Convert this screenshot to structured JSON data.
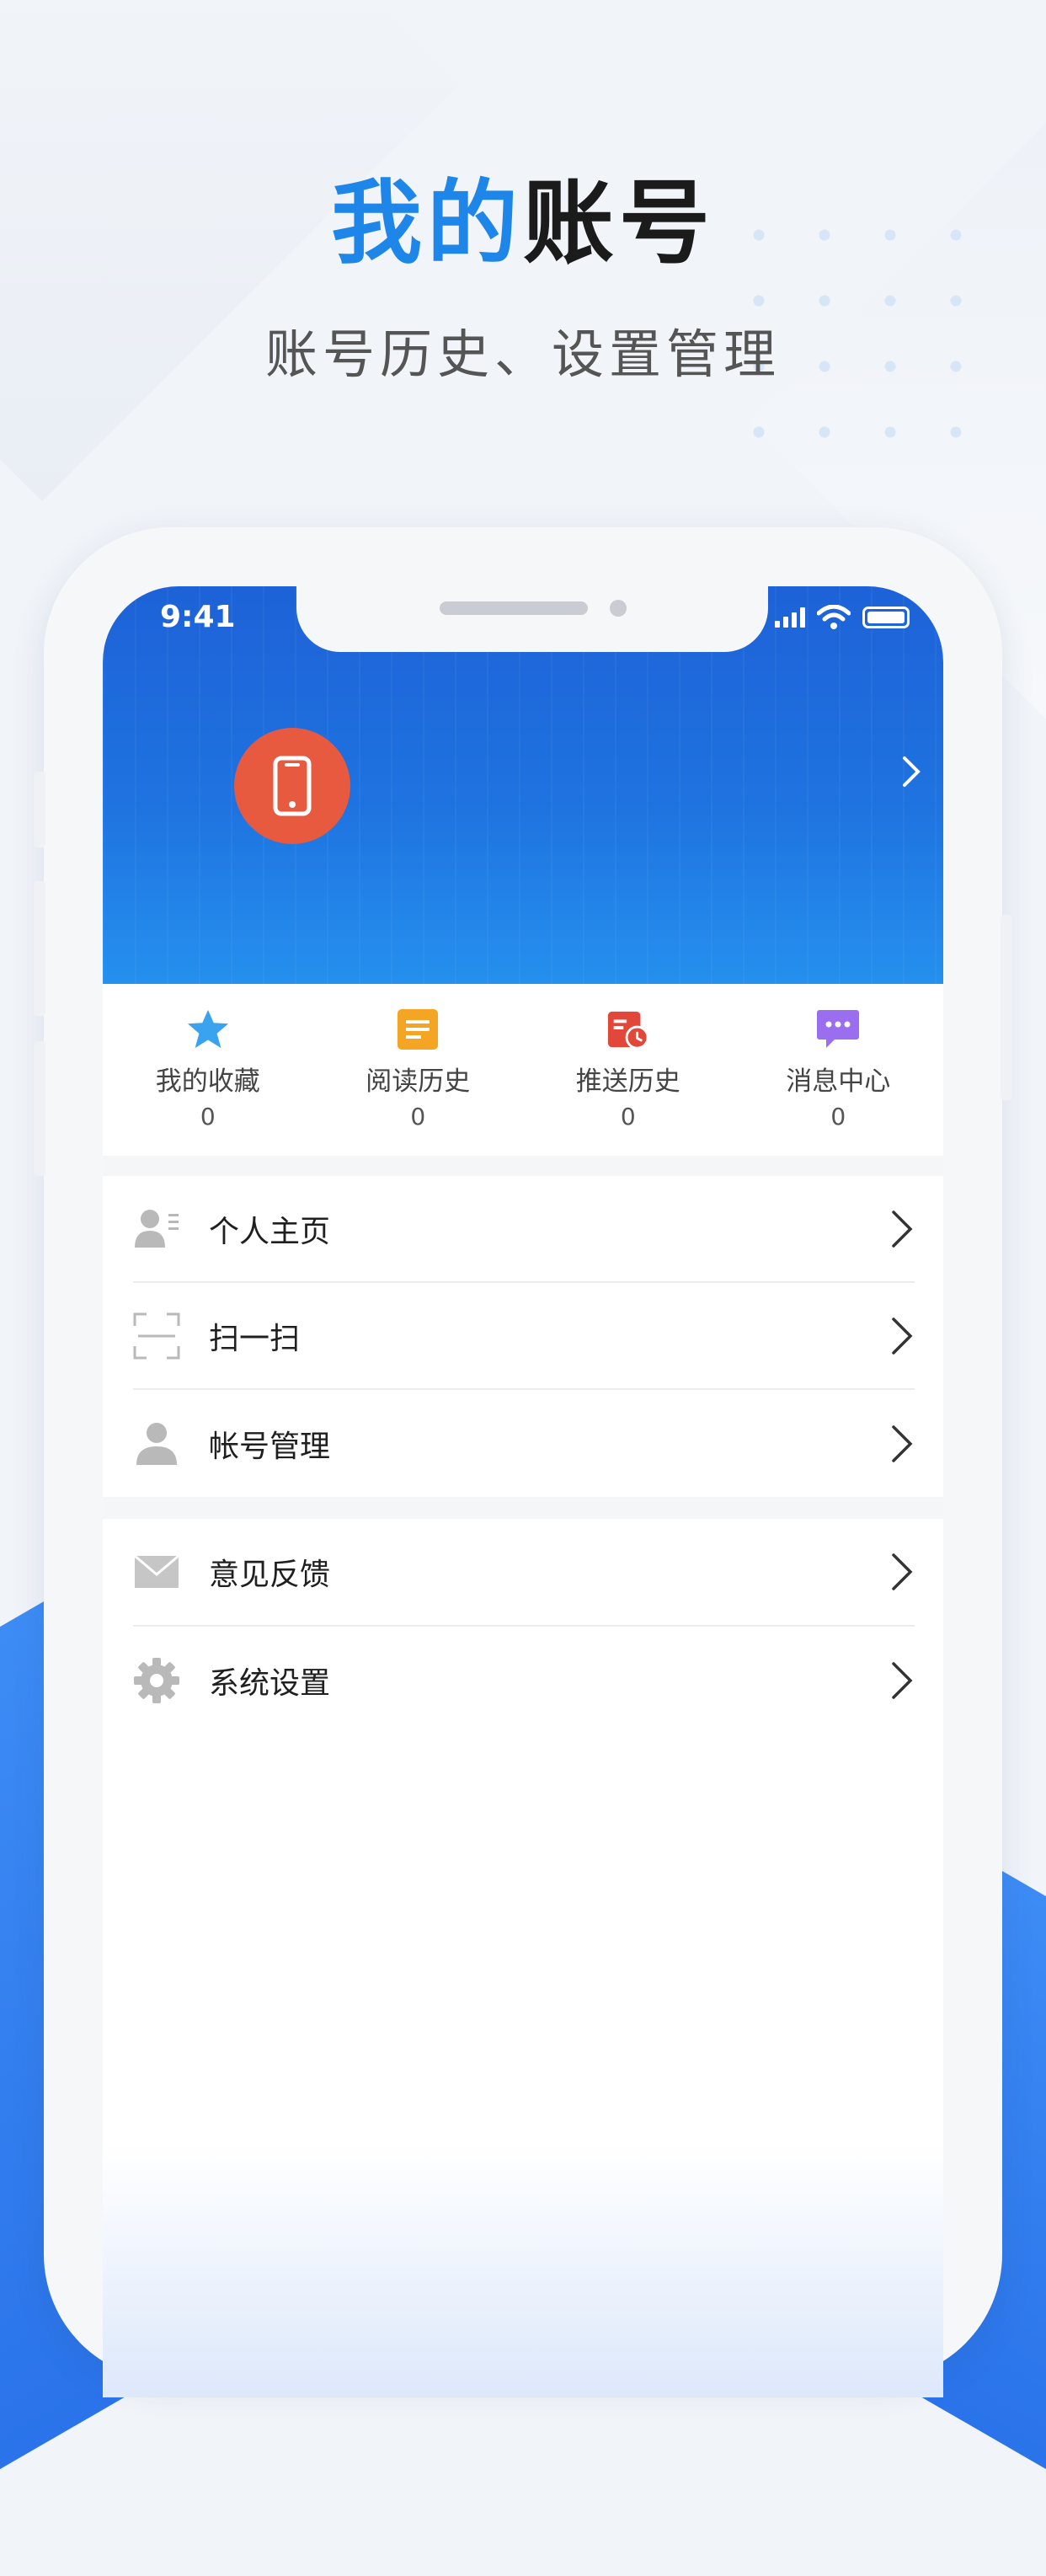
{
  "promo": {
    "title_blue": "我的",
    "title_dark": "账号",
    "subtitle": "账号历史、设置管理"
  },
  "status_bar": {
    "time": "9:41"
  },
  "quick_actions": [
    {
      "label": "我的收藏",
      "count": "0",
      "icon": "star-icon",
      "color": "#3aa3f0"
    },
    {
      "label": "阅读历史",
      "count": "0",
      "icon": "document-icon",
      "color": "#f4a524"
    },
    {
      "label": "推送历史",
      "count": "0",
      "icon": "calendar-clock-icon",
      "color": "#e2483a"
    },
    {
      "label": "消息中心",
      "count": "0",
      "icon": "message-icon",
      "color": "#9b6ef0"
    }
  ],
  "menu_group_1": [
    {
      "label": "个人主页",
      "icon": "profile-card-icon"
    },
    {
      "label": "扫一扫",
      "icon": "scan-icon"
    },
    {
      "label": "帐号管理",
      "icon": "user-icon"
    }
  ],
  "menu_group_2": [
    {
      "label": "意见反馈",
      "icon": "mail-icon"
    },
    {
      "label": "系统设置",
      "icon": "gear-icon"
    }
  ],
  "colors": {
    "brand_blue": "#1e86e8",
    "header_blue": "#1f73e0",
    "avatar_red": "#e85a40"
  }
}
